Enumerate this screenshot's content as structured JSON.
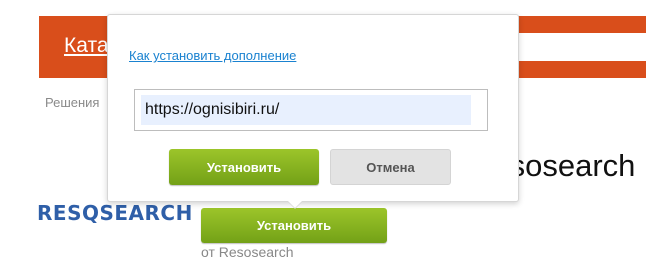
{
  "header": {
    "catalog_link": "Каталог",
    "accent_color": "#d94e1b"
  },
  "breadcrumb": "Решения",
  "page_title": "Resosearch",
  "logo_text": "RESQSEARCH",
  "main": {
    "install_label": "Установить",
    "byline": "от Resosearch"
  },
  "popup": {
    "help_link": "Как установить дополнение",
    "url_value": "https://ognisibiri.ru/",
    "install_label": "Установить",
    "cancel_label": "Отмена"
  },
  "colors": {
    "button_green": "#8ab520",
    "link_blue": "#1a82d0",
    "logo_blue": "#2f5fa8"
  }
}
